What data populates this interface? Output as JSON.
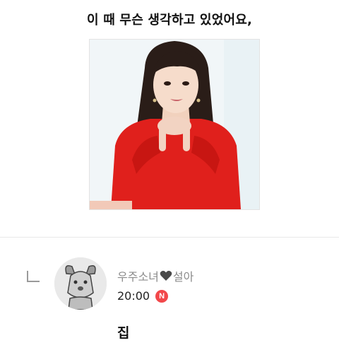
{
  "post": {
    "title": "이 때 무슨 생각하고 있었어요,"
  },
  "image": {
    "icon": "photo-of-woman-in-red-sweater"
  },
  "comment": {
    "reply_icon": "reply-arrow-icon",
    "avatar_icon": "default-dog-avatar",
    "author_prefix": "우주소녀",
    "author_suffix": "설아",
    "heart_color": "#4a4a4a",
    "time": "20:00",
    "new_badge": "N",
    "new_badge_color": "#f2474a",
    "body": "집"
  }
}
